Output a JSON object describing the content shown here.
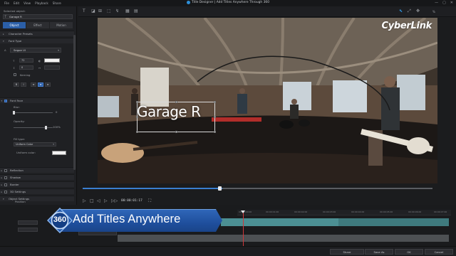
{
  "window": {
    "menu": [
      "File",
      "Edit",
      "View",
      "Playback",
      "Share"
    ],
    "title": "Title Designer | Add Titles Anywhere Through 360",
    "controls": [
      "—",
      "▢",
      "✕"
    ]
  },
  "left_panel": {
    "selected_object_label": "Selected object:",
    "selected_object_value": "Garage R",
    "tabs": [
      "Object",
      "Effect",
      "Motion"
    ],
    "sections": {
      "character_presets": "Character Presets",
      "font_type": "Font Type",
      "font_face": "Font Face",
      "reflection": "Reflection",
      "shadow": "Shadow",
      "border": "Border",
      "settings_3d": "3D Settings",
      "object_settings": "Object Settings"
    },
    "font_name": "Segoe UI",
    "font_size": "72",
    "line_spacing": "0",
    "kerning_label": "Kerning",
    "blur_label": "Blur:",
    "blur_value": "0",
    "opacity_label": "Opacity:",
    "opacity_value": "100%",
    "fill_type_label": "Fill type:",
    "fill_type_value": "Uniform Color",
    "uniform_color_label": "Uniform color:",
    "position_label": "Position",
    "position_x_label": "X:",
    "position_x_value": "0.235",
    "ease_in_label": "Ease in",
    "ease_out_label": "Ease out",
    "opacity_row_label": "Opacity"
  },
  "preview": {
    "brand": "CyberLink",
    "title_text": "Garage R"
  },
  "transport": {
    "timecode": "00:00:01:17"
  },
  "timeline": {
    "ticks": [
      "00:00:00:00",
      "00:00:01:00",
      "00:00:02:00",
      "00:00:03:00",
      "00:00:04:00",
      "00:00:05:00",
      "00:00:06:00",
      "00:00:07:00"
    ]
  },
  "banner": {
    "badge": "360",
    "text": "Add Titles Anywhere"
  },
  "bottom_buttons": {
    "share": "Share",
    "save_as": "Save As",
    "ok": "OK",
    "cancel": "Cancel"
  },
  "colors": {
    "accent": "#2b5fa8",
    "playhead": "#d0373a",
    "track": "#4c8f93",
    "banner": "#2f66b8"
  }
}
